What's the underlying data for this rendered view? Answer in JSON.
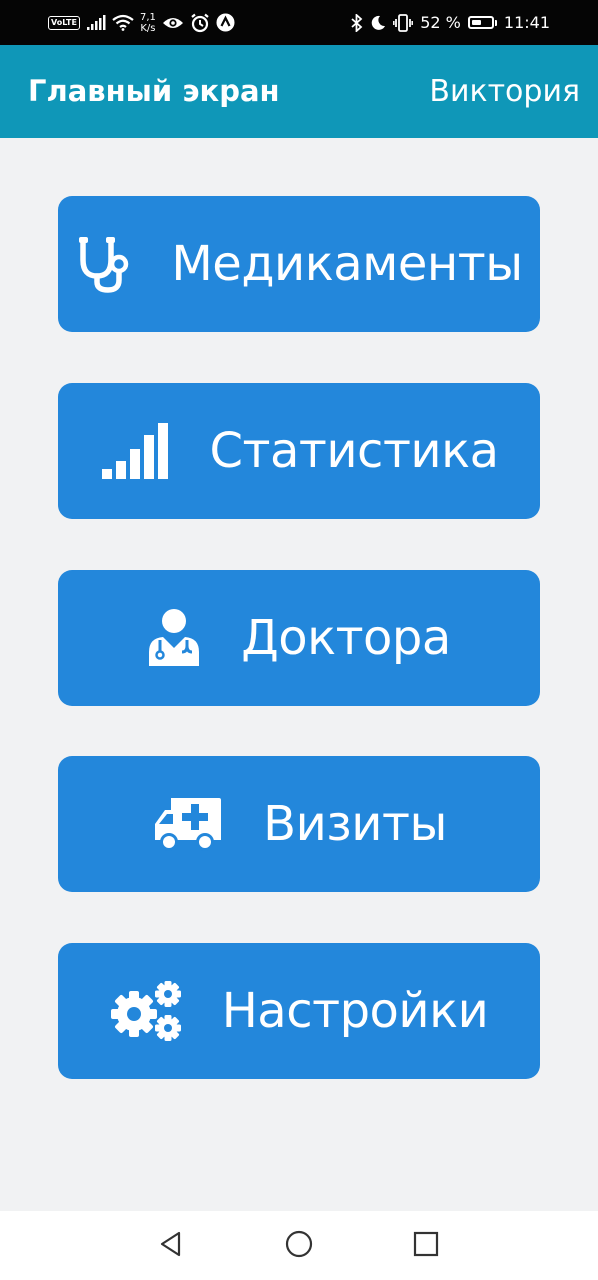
{
  "status_bar": {
    "volte": "VoLTE",
    "speed_value": "7,1",
    "speed_unit": "K/s",
    "battery_percent": "52 %",
    "battery_level": 0.52,
    "time": "11:41",
    "icons": [
      "signal-icon",
      "wifi-icon",
      "eye-icon",
      "alarm-icon",
      "app-notification-icon",
      "bluetooth-icon",
      "moon-icon",
      "vibrate-icon",
      "battery-icon"
    ]
  },
  "app_bar": {
    "title": "Главный экран",
    "user": "Виктория"
  },
  "menu": [
    {
      "label": "Медикаменты",
      "icon": "stethoscope-icon"
    },
    {
      "label": "Статистика",
      "icon": "signal-bars-icon"
    },
    {
      "label": "Доктора",
      "icon": "doctor-icon"
    },
    {
      "label": "Визиты",
      "icon": "ambulance-icon"
    },
    {
      "label": "Настройки",
      "icon": "gears-icon"
    }
  ],
  "nav_bar": {
    "icons": [
      "back-triangle-icon",
      "home-circle-icon",
      "recent-square-icon"
    ]
  },
  "colors": {
    "status_bar_bg": "#050505",
    "app_bar_bg": "#0f97b8",
    "button_bg": "#2387db",
    "page_bg": "#f1f2f3",
    "nav_bar_bg": "#ffffff"
  }
}
